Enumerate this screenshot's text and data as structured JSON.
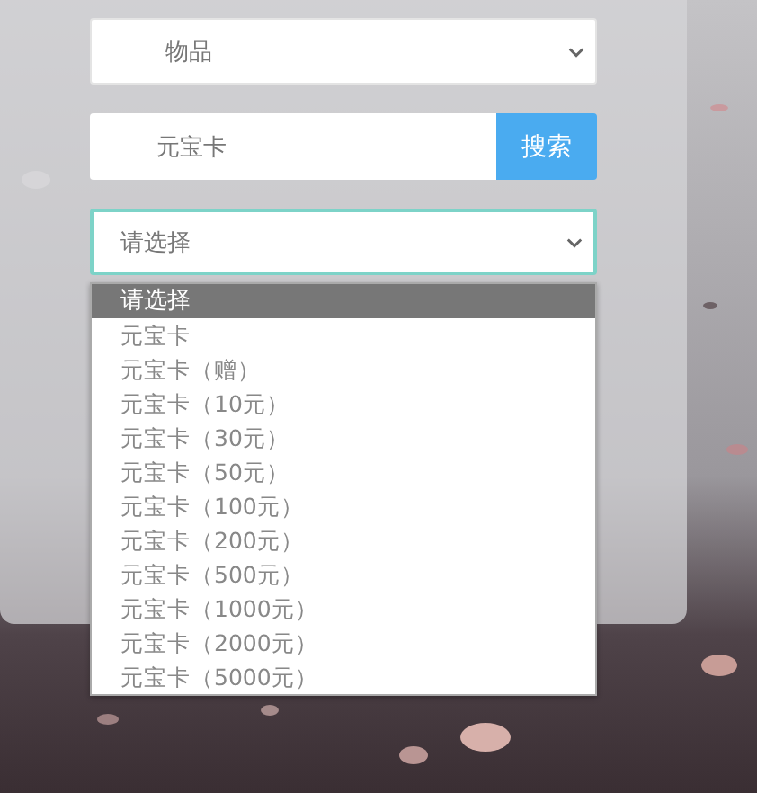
{
  "category_select": {
    "value": "物品"
  },
  "search": {
    "value": "元宝卡",
    "button": "搜索"
  },
  "item_select": {
    "value": "请选择",
    "focused": true,
    "expanded": true,
    "options": [
      {
        "label": "请选择",
        "selected": true
      },
      {
        "label": "元宝卡",
        "selected": false
      },
      {
        "label": "元宝卡（赠）",
        "selected": false
      },
      {
        "label": "元宝卡（10元）",
        "selected": false
      },
      {
        "label": "元宝卡（30元）",
        "selected": false
      },
      {
        "label": "元宝卡（50元）",
        "selected": false
      },
      {
        "label": "元宝卡（100元）",
        "selected": false
      },
      {
        "label": "元宝卡（200元）",
        "selected": false
      },
      {
        "label": "元宝卡（500元）",
        "selected": false
      },
      {
        "label": "元宝卡（1000元）",
        "selected": false
      },
      {
        "label": "元宝卡（2000元）",
        "selected": false
      },
      {
        "label": "元宝卡（5000元）",
        "selected": false
      }
    ]
  }
}
